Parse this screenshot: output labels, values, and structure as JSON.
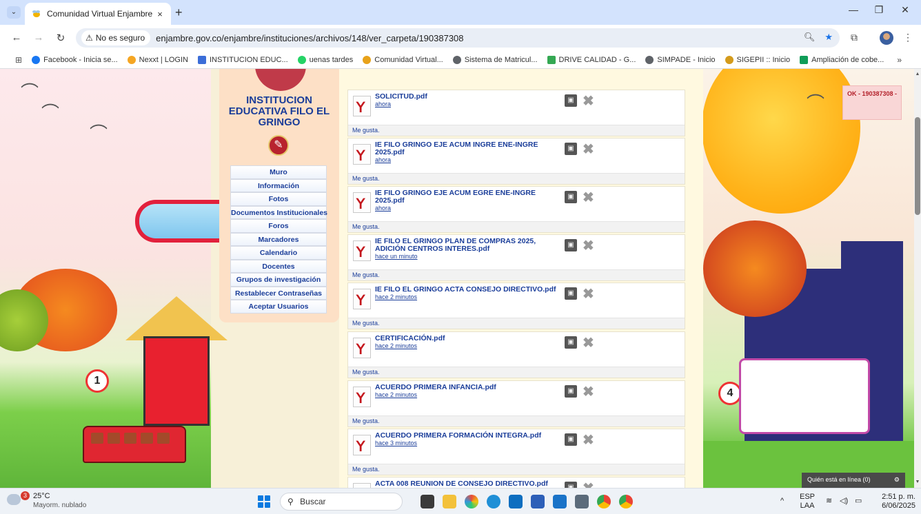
{
  "browser": {
    "tab_title": "Comunidad Virtual Enjambre",
    "tab_close": "×",
    "new_tab": "+",
    "security_label": "No es seguro",
    "url": "enjambre.gov.co/enjambre/instituciones/archivos/148/ver_carpeta/190387308",
    "bookmarks": [
      {
        "label": "Facebook - Inicia se...",
        "color": "#1877f2"
      },
      {
        "label": "Nexxt | LOGIN",
        "color": "#f5a623"
      },
      {
        "label": "INSTITUCION EDUC...",
        "color": "#3b6dd8"
      },
      {
        "label": "uenas tardes",
        "color": "#25d366"
      },
      {
        "label": "Comunidad Virtual...",
        "color": "#e8a21a"
      },
      {
        "label": "Sistema de Matricul...",
        "color": "#5f6368"
      },
      {
        "label": "DRIVE CALIDAD - G...",
        "color": "#34a853"
      },
      {
        "label": "SIMPADE - Inicio",
        "color": "#5f6368"
      },
      {
        "label": "SIGEPII :: Inicio",
        "color": "#d49b1c"
      },
      {
        "label": "Ampliación de cobe...",
        "color": "#0f9d58"
      }
    ],
    "bookmarks_more": "»"
  },
  "site": {
    "school_name": "INSTITUCION EDUCATIVA FILO EL GRINGO",
    "menu": [
      "Muro",
      "Información",
      "Fotos",
      "Documentos Institucionales",
      "Foros",
      "Marcadores",
      "Calendario",
      "Docentes",
      "Grupos de investigación",
      "Restablecer Contraseñas",
      "Aceptar Usuarios"
    ],
    "like_label": "Me gusta.",
    "files": [
      {
        "name": "SOLICITUD.pdf",
        "time": "ahora"
      },
      {
        "name": "IE FILO GRINGO EJE ACUM INGRE ENE-INGRE 2025.pdf",
        "time": "ahora"
      },
      {
        "name": "IE FILO GRINGO EJE ACUM EGRE ENE-INGRE 2025.pdf",
        "time": "ahora"
      },
      {
        "name": "IE FILO EL GRINGO PLAN DE COMPRAS 2025, ADICIÓN CENTROS INTERES.pdf",
        "time": "hace un minuto"
      },
      {
        "name": "IE FILO EL GRINGO ACTA CONSEJO DIRECTIVO.pdf",
        "time": "hace 2 minutos"
      },
      {
        "name": "CERTIFICACIÓN.pdf",
        "time": "hace 2 minutos"
      },
      {
        "name": "ACUERDO PRIMERA INFANCIA.pdf",
        "time": "hace 2 minutos"
      },
      {
        "name": "ACUERDO PRIMERA FORMACIÓN INTEGRA.pdf",
        "time": "hace 3 minutos"
      },
      {
        "name": "ACTA 008 REUNION DE CONSEJO DIRECTIVO.pdf",
        "time": ""
      }
    ],
    "ok_notice": "OK - 190387308 -",
    "online_label": "Quién está en línea (0)"
  },
  "taskbar": {
    "weather_temp": "25°C",
    "weather_desc": "Mayorm. nublado",
    "weather_badge": "3",
    "search_placeholder": "Buscar",
    "lang_top": "ESP",
    "lang_bottom": "LAA",
    "time": "2:51 p. m.",
    "date": "6/06/2025"
  }
}
